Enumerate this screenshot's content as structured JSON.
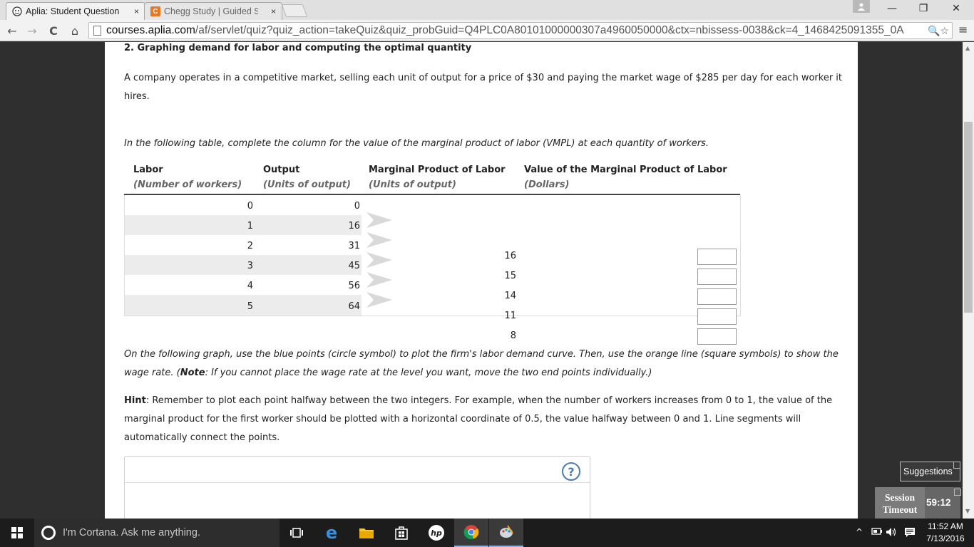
{
  "browser": {
    "tabs": [
      {
        "title": "Aplia: Student Question",
        "close": "×"
      },
      {
        "title": "Chegg Study | Guided Sol",
        "close": "×"
      }
    ],
    "window_controls": {
      "minimize": "—",
      "maximize": "❐",
      "close": "✕"
    },
    "nav": {
      "back": "←",
      "forward": "→",
      "reload": "C",
      "home": "⌂"
    },
    "url_host": "courses.aplia.com",
    "url_path": "/af/servlet/quiz?quiz_action=takeQuiz&quiz_probGuid=Q4PLC0A80101000000307a4960050000&ctx=nbissess-0038&ck=4_1468425091355_0A",
    "omnibox_icons": "🔍☆",
    "menu": "≡"
  },
  "question": {
    "title": "2. Graphing demand for labor and computing the optimal quantity",
    "intro": "A company operates in a competitive market, selling each unit of output for a price of $30 and paying the market wage of $285 per day for each worker it hires.",
    "instruction": "In the following table, complete the column for the value of the marginal product of labor (VMPL) at each quantity of workers.",
    "table": {
      "headers": [
        {
          "title": "Labor",
          "sub": "(Number of workers)"
        },
        {
          "title": "Output",
          "sub": "(Units of output)"
        },
        {
          "title": "Marginal Product of Labor",
          "sub": "(Units of output)"
        },
        {
          "title": "Value of the Marginal Product of Labor",
          "sub": "(Dollars)"
        }
      ],
      "rows": [
        {
          "labor": "0",
          "output": "0"
        },
        {
          "labor": "1",
          "output": "16"
        },
        {
          "labor": "2",
          "output": "31"
        },
        {
          "labor": "3",
          "output": "45"
        },
        {
          "labor": "4",
          "output": "56"
        },
        {
          "labor": "5",
          "output": "64"
        }
      ],
      "mpl": [
        "16",
        "15",
        "14",
        "11",
        "8"
      ],
      "vmpl_inputs": [
        "",
        "",
        "",
        "",
        ""
      ]
    },
    "graph_instruction_part1": "On the following graph, use the blue points (circle symbol) to plot the firm's labor demand curve. Then, use the orange line (square symbols) to show the wage rate. (",
    "graph_instruction_note": "Note",
    "graph_instruction_part2": ": If you cannot place the wage rate at the level you want, move the two end points individually.)",
    "hint_label": "Hint",
    "hint_text": ": Remember to plot each point halfway between the two integers. For example, when the number of workers increases from 0 to 1, the value of the marginal product for the first worker should be plotted with a horizontal coordinate of 0.5, the value halfway between 0 and 1. Line segments will automatically connect the points.",
    "help_icon": "?"
  },
  "widgets": {
    "suggestions": "Suggestions",
    "session_label_1": "Session",
    "session_label_2": "Timeout",
    "session_timer": "59:12"
  },
  "taskbar": {
    "cortana": "I'm Cortana. Ask me anything.",
    "time": "11:52 AM",
    "date": "7/13/2016"
  }
}
